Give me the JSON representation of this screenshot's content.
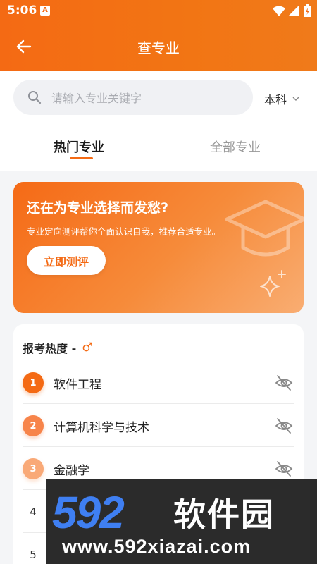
{
  "status_bar": {
    "time": "5:06",
    "notification_badge": "A",
    "icons": [
      "wifi-icon",
      "signal-icon",
      "battery-icon"
    ]
  },
  "header": {
    "title": "查专业",
    "back_icon": "arrow-left-icon",
    "background_color": "#f46a14"
  },
  "search": {
    "placeholder": "请输入专业关键字",
    "icon": "search-icon"
  },
  "degree_filter": {
    "selected": "本科",
    "icon": "chevron-down-icon"
  },
  "tabs": [
    {
      "label": "热门专业",
      "active": true
    },
    {
      "label": "全部专业",
      "active": false
    }
  ],
  "banner": {
    "title": "还在为专业选择而发愁?",
    "subtitle": "专业定向测评帮你全面认识自我，推荐合适专业。",
    "button_label": "立即测评",
    "icons": [
      "graduation-cap-icon",
      "sparkle-icon"
    ]
  },
  "ranking": {
    "heading": "报考热度 -",
    "gender_icon": "♂",
    "items": [
      {
        "rank": "1",
        "name": "软件工程"
      },
      {
        "rank": "2",
        "name": "计算机科学与技术"
      },
      {
        "rank": "3",
        "name": "金融学"
      },
      {
        "rank": "4",
        "name": ""
      },
      {
        "rank": "5",
        "name": ""
      }
    ]
  },
  "watermark": {
    "digits": "592",
    "text": "软件园",
    "url": "www.592xiazai.com"
  },
  "colors": {
    "accent": "#f46a14",
    "rank_badge_1": "#f46a14",
    "rank_badge_2": "#f7844a",
    "rank_badge_3": "#f9a977"
  }
}
